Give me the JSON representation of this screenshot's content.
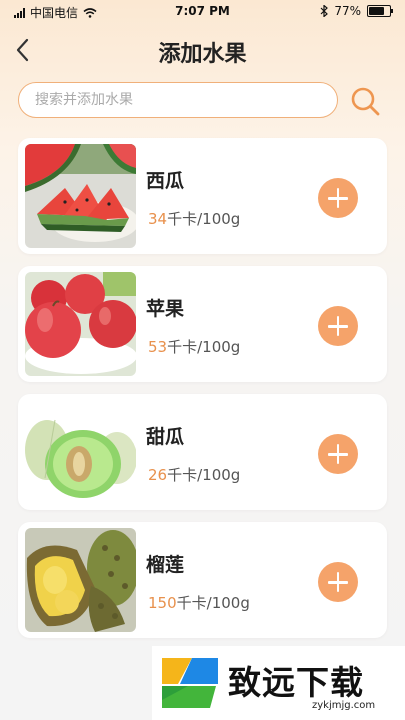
{
  "status_bar": {
    "carrier": "中国电信",
    "time": "7:07 PM",
    "battery": "77%",
    "battery_level": 0.77
  },
  "header": {
    "title": "添加水果",
    "back_icon": "chevron-left-icon"
  },
  "search": {
    "placeholder": "搜索并添加水果",
    "icon": "search-icon",
    "accent": "#f0b07a"
  },
  "fruits": [
    {
      "name": "西瓜",
      "kcal": "34",
      "unit": "千卡/100g",
      "image": "watermelon"
    },
    {
      "name": "苹果",
      "kcal": "53",
      "unit": "千卡/100g",
      "image": "apple"
    },
    {
      "name": "甜瓜",
      "kcal": "26",
      "unit": "千卡/100g",
      "image": "melon"
    },
    {
      "name": "榴莲",
      "kcal": "150",
      "unit": "千卡/100g",
      "image": "durian"
    }
  ],
  "colors": {
    "accent_orange": "#f5a36a",
    "kcal_number": "#e8914d"
  },
  "watermark": {
    "text": "致远下载",
    "url": "zykjmjg.com"
  }
}
